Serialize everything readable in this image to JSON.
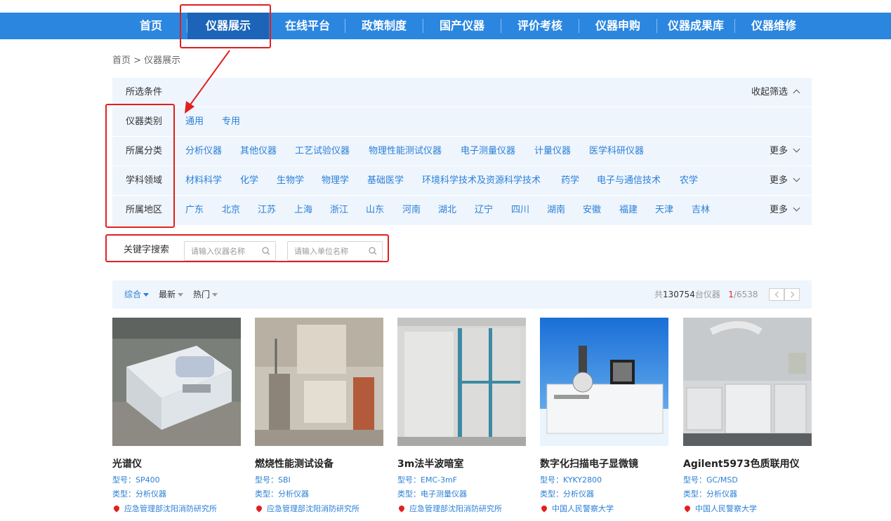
{
  "nav": {
    "items": [
      "首页",
      "仪器展示",
      "在线平台",
      "政策制度",
      "国产仪器",
      "评价考核",
      "仪器申购",
      "仪器成果库",
      "仪器维修"
    ],
    "active_index": 1,
    "color": "#2b86e0",
    "active_color": "#1b64b8"
  },
  "breadcrumb": "首页 > 仪器展示",
  "filter": {
    "header_label": "所选条件",
    "collapse_label": "收起筛选",
    "more_label": "更多",
    "rows": [
      {
        "label": "仪器类别",
        "options": [
          "通用",
          "专用"
        ]
      },
      {
        "label": "所属分类",
        "options": [
          "分析仪器",
          "其他仪器",
          "工艺试验仪器",
          "物理性能测试仪器",
          "电子测量仪器",
          "计量仪器",
          "医学科研仪器"
        ]
      },
      {
        "label": "学科领域",
        "options": [
          "材料科学",
          "化学",
          "生物学",
          "物理学",
          "基础医学",
          "环境科学技术及资源科学技术",
          "药学",
          "电子与通信技术",
          "农学"
        ]
      },
      {
        "label": "所属地区",
        "options": [
          "广东",
          "北京",
          "江苏",
          "上海",
          "浙江",
          "山东",
          "河南",
          "湖北",
          "辽宁",
          "四川",
          "湖南",
          "安徽",
          "福建",
          "天津",
          "吉林"
        ]
      }
    ]
  },
  "search": {
    "label": "关键字搜索",
    "instrument_placeholder": "请输入仪器名称",
    "unit_placeholder": "请输入单位名称"
  },
  "sort": {
    "options": [
      "综合",
      "最新",
      "热门"
    ],
    "active_index": 0,
    "total_prefix": "共",
    "total": "130754",
    "total_suffix": "台仪器",
    "current_page": "1",
    "total_pages": "/6538"
  },
  "cards": [
    {
      "title": "光谱仪",
      "model": "型号：SP400",
      "type": "类型：分析仪器",
      "org": "应急管理部沈阳消防研究所",
      "image": "spectrometer-photo"
    },
    {
      "title": "燃烧性能测试设备",
      "model": "型号：SBI",
      "type": "类型：分析仪器",
      "org": "应急管理部沈阳消防研究所",
      "image": "combustion-test-equipment-photo"
    },
    {
      "title": "3m法半波暗室",
      "model": "型号：EMC-3mF",
      "type": "类型：电子测量仪器",
      "org": "应急管理部沈阳消防研究所",
      "image": "anechoic-chamber-photo"
    },
    {
      "title": "数字化扫描电子显微镜",
      "model": "型号：KYKY2800",
      "type": "类型：分析仪器",
      "org": "中国人民警察大学",
      "image": "electron-microscope-photo"
    },
    {
      "title": "Agilent5973色质联用仪",
      "model": "型号：GC/MSD",
      "type": "类型：分析仪器",
      "org": "中国人民警察大学",
      "image": "gc-ms-photo"
    }
  ]
}
